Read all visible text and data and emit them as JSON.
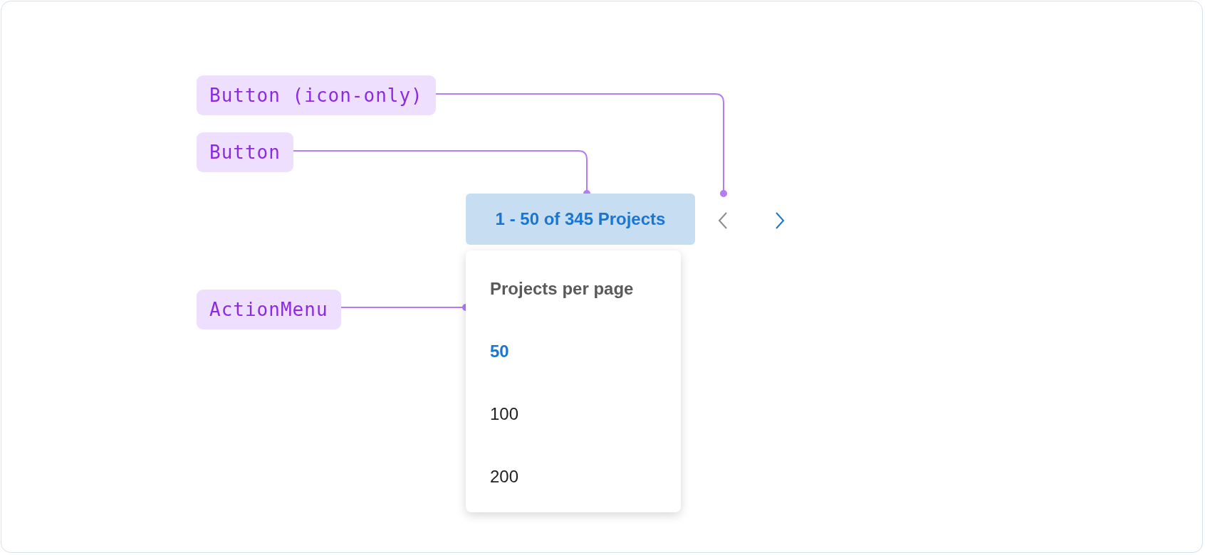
{
  "annotations": [
    {
      "label": "Button (icon-only)"
    },
    {
      "label": "Button"
    },
    {
      "label": "ActionMenu"
    }
  ],
  "pagination": {
    "range_button": "1 - 50 of 345 Projects",
    "previous": {
      "disabled": true
    },
    "next": {
      "disabled": false
    }
  },
  "menu": {
    "title": "Projects per page",
    "items": [
      {
        "label": "50",
        "selected": true
      },
      {
        "label": "100",
        "selected": false
      },
      {
        "label": "200",
        "selected": false
      }
    ]
  }
}
